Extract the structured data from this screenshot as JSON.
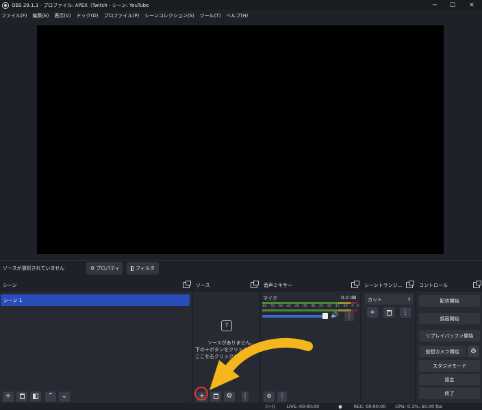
{
  "window": {
    "title": "OBS 29.1.3 - プロファイル: APEX（Twitch - シーン: YouTube",
    "minimize_glyph": "─",
    "maximize_glyph": "☐",
    "close_glyph": "✕"
  },
  "menu": [
    "ファイル(F)",
    "編集(E)",
    "表示(V)",
    "ドック(D)",
    "プロファイル(P)",
    "シーンコレクション(S)",
    "ツール(T)",
    "ヘルプ(H)"
  ],
  "context_bar": {
    "no_source_label": "ソースが選択されていません",
    "properties_label": "プロパティ",
    "filters_label": "フィルタ"
  },
  "scenes": {
    "header": "シーン",
    "items": [
      "シーン 1"
    ]
  },
  "sources": {
    "header": "ソース",
    "empty_icon": "?",
    "empty_line1": "ソースがありません。",
    "empty_line2": "下の＋ボタンをクリック",
    "empty_line3": "ここを右クリックして"
  },
  "mixer": {
    "header": "音声ミキサー",
    "channel_name": "マイク",
    "level": "0.0 dB",
    "scale": [
      "-60",
      "-55",
      "-50",
      "-45",
      "-40",
      "-35",
      "-30",
      "-25",
      "-20",
      "-15",
      "-10",
      "-5",
      "0"
    ],
    "volume_fraction": 1.0
  },
  "transitions": {
    "header": "シーントランジ...",
    "selected": "カット"
  },
  "controls": {
    "header": "コントロール",
    "buttons": [
      "配信開始",
      "録画開始",
      "リプレイバッファ開始",
      "仮想カメラ開始",
      "スタジオモード",
      "設定",
      "終了"
    ]
  },
  "status": {
    "live": "LIVE: 00:00:00",
    "rec": "REC: 00:00:00",
    "cpu": "CPU: 0.1%, 60.00 fps"
  },
  "colors": {
    "selected_scene": "#284cb8",
    "highlight_circle": "#e6362e",
    "arrow": "#f5b61c",
    "volume": "#3b6ad4"
  }
}
